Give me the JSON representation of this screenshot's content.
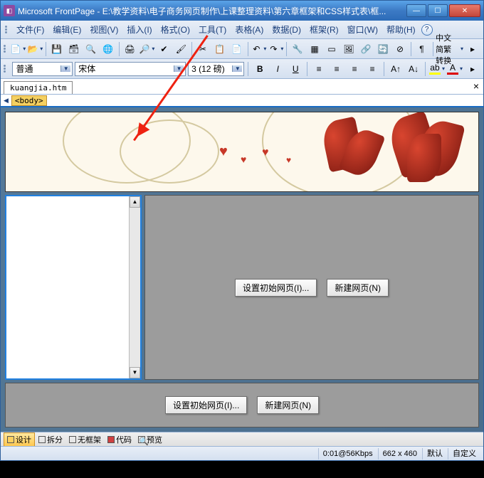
{
  "title": "Microsoft FrontPage - E:\\教学资料\\电子商务网页制作\\上课整理资料\\第六章框架和CSS样式表\\框...",
  "menus": {
    "file": "文件(F)",
    "edit": "编辑(E)",
    "view": "视图(V)",
    "insert": "插入(I)",
    "format": "格式(O)",
    "tools": "工具(T)",
    "table": "表格(A)",
    "data": "数据(D)",
    "frame": "框架(R)",
    "window": "窗口(W)",
    "help": "帮助(H)"
  },
  "toolbar2": {
    "convert": "中文简繁转换"
  },
  "format": {
    "style": "普通",
    "font": "宋体",
    "size": "3 (12 磅)"
  },
  "tab": {
    "filename": "kuangjia.htm"
  },
  "crumb": {
    "tag": "<body>"
  },
  "frame": {
    "btn_set": "设置初始网页(I)...",
    "btn_new": "新建网页(N)"
  },
  "views": {
    "design": "设计",
    "split": "拆分",
    "noframes": "无框架",
    "code": "代码",
    "preview": "预览"
  },
  "status": {
    "speed": "0:01@56Kbps",
    "dims": "662 x 460",
    "default": "默认",
    "custom": "自定义"
  }
}
